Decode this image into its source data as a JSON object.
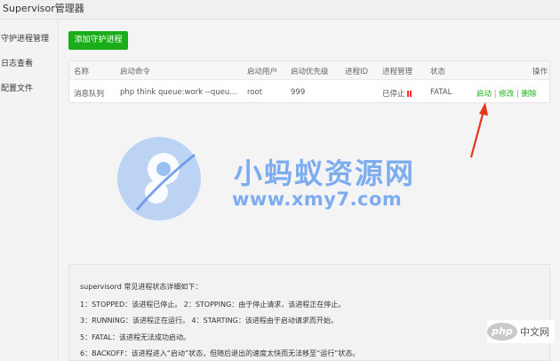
{
  "window": {
    "title": "Supervisor管理器"
  },
  "sidebar": {
    "items": [
      {
        "label": "守护进程管理"
      },
      {
        "label": "日志查看"
      },
      {
        "label": "配置文件"
      }
    ]
  },
  "toolbar": {
    "add_label": "添加守护进程"
  },
  "table": {
    "headers": {
      "name": "名称",
      "command": "启动命令",
      "user": "启动用户",
      "priority": "启动优先级",
      "pid": "进程ID",
      "process_mgmt": "进程管理",
      "state": "状态",
      "ops": "操作"
    },
    "rows": [
      {
        "name": "消息队列",
        "command": "php think queue:work --queu...",
        "user": "root",
        "priority": "999",
        "pid": "",
        "process_status": "已停止",
        "state": "FATAL",
        "ops": {
          "start": "启动",
          "edit": "修改",
          "delete": "删除",
          "sep": "|"
        }
      }
    ]
  },
  "watermark": {
    "line1": "小蚂蚁资源网",
    "line2": "www.xmy7.com"
  },
  "info": {
    "lines": [
      "supervisord 常见进程状态详细如下：",
      "1：STOPPED：该进程已停止。      2：STOPPING：由于停止请求，该进程正在停止。",
      "3：RUNNING：该进程正在运行。  4：STARTING：该进程由于启动请求而开始。",
      "5：FATAL：该进程无法成功启动。",
      "6：BACKOFF：该进程进入“启动”状态，但随后退出的速度太快而无法移至“运行”状态。"
    ]
  },
  "badge": {
    "logo": "php",
    "text": "中文网"
  },
  "colors": {
    "accent_green": "#1aad19",
    "stopped_red": "#ff2a2a",
    "arrow_red": "#e8341c",
    "watermark_blue": "#69a0f0"
  },
  "icons": {
    "annotation": "red-arrow",
    "watermark_logo": "blue-ant-logo"
  }
}
